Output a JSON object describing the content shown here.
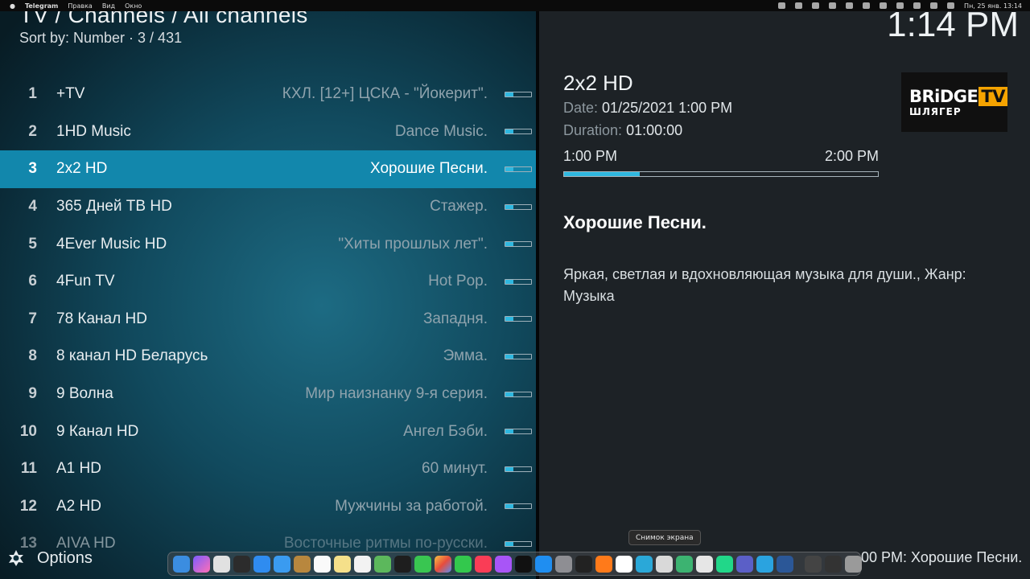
{
  "menubar": {
    "apple": "",
    "app": "Telegram",
    "items": [
      "Правка",
      "Вид",
      "Окно"
    ],
    "datetime": "Пн, 25 янв.  13:14"
  },
  "header": {
    "breadcrumb": "TV / Channels / All channels",
    "sort": "Sort by: Number  ·  3 / 431",
    "clock": "1:14 PM"
  },
  "channels": [
    {
      "num": "1",
      "name": "+TV",
      "program": "КХЛ. [12+] ЦСКА - \"Йокерит\".",
      "progress": 0.3
    },
    {
      "num": "2",
      "name": "1HD Music",
      "program": "Dance Music.",
      "progress": 0.3
    },
    {
      "num": "3",
      "name": "2x2 HD",
      "program": "Хорошие Песни.",
      "progress": 0.3,
      "selected": true
    },
    {
      "num": "4",
      "name": "365 Дней ТВ HD",
      "program": "Стажер.",
      "progress": 0.3
    },
    {
      "num": "5",
      "name": "4Ever Music HD",
      "program": "\"Хиты прошлых лет\".",
      "progress": 0.3
    },
    {
      "num": "6",
      "name": "4Fun TV",
      "program": "Hot Pop.",
      "progress": 0.3
    },
    {
      "num": "7",
      "name": "78 Канал HD",
      "program": "Западня.",
      "progress": 0.3
    },
    {
      "num": "8",
      "name": "8 канал HD Беларусь",
      "program": "Эмма.",
      "progress": 0.3
    },
    {
      "num": "9",
      "name": "9 Волна",
      "program": "Мир наизнанку 9-я серия.",
      "progress": 0.3
    },
    {
      "num": "10",
      "name": "9 Канал HD",
      "program": "Ангел Бэби.",
      "progress": 0.3
    },
    {
      "num": "11",
      "name": "A1 HD",
      "program": "60 минут.",
      "progress": 0.3
    },
    {
      "num": "12",
      "name": "A2 HD",
      "program": "Мужчины за работой.",
      "progress": 0.3
    },
    {
      "num": "13",
      "name": "AIVA HD",
      "program": "Восточные ритмы по-русски.",
      "progress": 0.3
    }
  ],
  "detail": {
    "channel": "2x2 HD",
    "date_label": "Date:",
    "date_value": "01/25/2021 1:00 PM",
    "duration_label": "Duration:",
    "duration_value": "01:00:00",
    "start": "1:00 PM",
    "end": "2:00 PM",
    "progress": 0.24,
    "logo_line1": "BRiDGE",
    "logo_tv": "TV",
    "logo_line2": "ШЛЯГЕР",
    "program_title": "Хорошие Песни.",
    "description": "Яркая, светлая и вдохновляющая музыка для души., Жанр: Музыка"
  },
  "footer": {
    "options": "Options",
    "next": "00 PM: Хорошие Песни."
  },
  "tooltip": "Снимок экрана",
  "colors": {
    "selected_row": "#1287ac",
    "progress_fill": "#2fb8e0",
    "right_pane": "#1d2226"
  }
}
